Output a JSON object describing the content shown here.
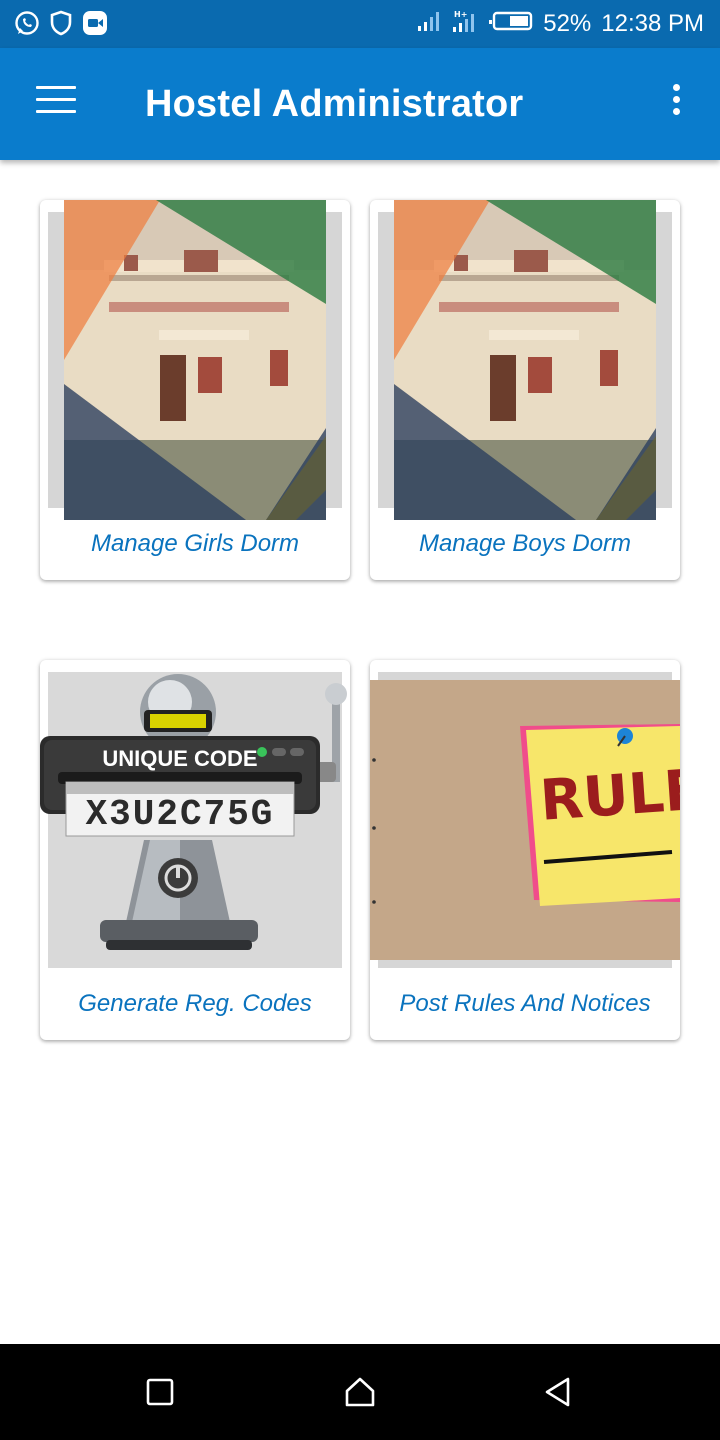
{
  "status_bar": {
    "battery": "52%",
    "time": "12:38 PM",
    "left_icons": [
      "whatsapp-icon",
      "shield-icon",
      "video-call-icon"
    ],
    "right_icons": [
      "signal-icon",
      "signal-hplus-icon",
      "battery-icon"
    ]
  },
  "app_bar": {
    "title": "Hostel Administrator",
    "menu_icon": "hamburger-menu-icon",
    "overflow_icon": "more-vert-icon",
    "color": "#0a7ccc"
  },
  "cards": [
    {
      "label": "Manage Girls Dorm",
      "image": "hostel-building-image"
    },
    {
      "label": "Manage Boys Dorm",
      "image": "hostel-building-image"
    },
    {
      "label": "Generate Reg. Codes",
      "image": "unique-code-machine-image",
      "image_text": {
        "title": "UNIQUE CODE",
        "code": "X3U2C75G"
      }
    },
    {
      "label": "Post Rules And Notices",
      "image": "rules-sticky-note-image",
      "image_text": {
        "note": "RULES"
      }
    }
  ],
  "accent_color": "#0a73be",
  "nav_bar": {
    "buttons": [
      "recents-square-icon",
      "home-icon",
      "back-triangle-icon"
    ]
  }
}
